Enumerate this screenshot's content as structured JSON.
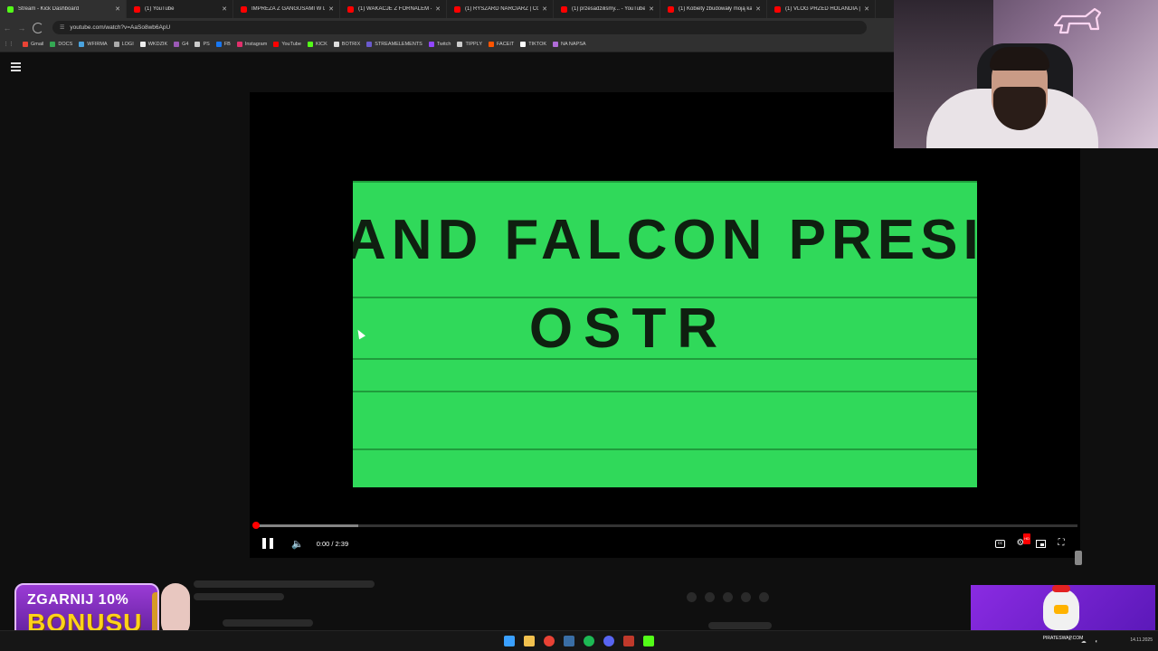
{
  "browser": {
    "tabs": [
      {
        "label": "Stream - Kick Dashboard",
        "favicon": "kick-icon",
        "active": true
      },
      {
        "label": "(1) YouTube",
        "favicon": "youtube-icon",
        "active": false
      },
      {
        "label": "IMPREZA Z GANGUSAMI W DI",
        "favicon": "youtube-icon",
        "active": false
      },
      {
        "label": "(1) WAKACJE Z FORNALEM - Y",
        "favicon": "youtube-icon",
        "active": false
      },
      {
        "label": "(1) RYSZARD NARCIARZ | CO T",
        "favicon": "youtube-icon",
        "active": false
      },
      {
        "label": "(1) przesadziliśmy... - YouTube",
        "favicon": "youtube-icon",
        "active": false
      },
      {
        "label": "(1) Kobiety zbudowały moją ka",
        "favicon": "youtube-icon",
        "active": false
      },
      {
        "label": "(1) VLOG PRZED HOLANDIA | C",
        "favicon": "youtube-icon",
        "active": false
      }
    ],
    "tab_close": "✕",
    "url": "youtube.com/watch?v=AaSo8wb6ApU",
    "bookmarks": [
      {
        "label": "Gmail",
        "color": "#ea4335"
      },
      {
        "label": "DOCS",
        "color": "#34a853"
      },
      {
        "label": "WFIRMA",
        "color": "#4aa3df"
      },
      {
        "label": "LOGI",
        "color": "#aaaaaa"
      },
      {
        "label": "WKDZIK",
        "color": "#eeeeee"
      },
      {
        "label": "G4",
        "color": "#9b59b6"
      },
      {
        "label": "PS",
        "color": "#cccccc"
      },
      {
        "label": "FB",
        "color": "#1877f2"
      },
      {
        "label": "Instagram",
        "color": "#e1306c"
      },
      {
        "label": "YouTube",
        "color": "#ff0000"
      },
      {
        "label": "KICK",
        "color": "#53fc18"
      },
      {
        "label": "BOTRIX",
        "color": "#dddddd"
      },
      {
        "label": "STREAMELEMENTS",
        "color": "#6a5acd"
      },
      {
        "label": "Twitch",
        "color": "#9146ff"
      },
      {
        "label": "TIPPLY",
        "color": "#cccccc"
      },
      {
        "label": "FACEIT",
        "color": "#ff5500"
      },
      {
        "label": "TIKTOK",
        "color": "#ffffff"
      },
      {
        "label": "NA NAPSA",
        "color": "#b06cd8"
      }
    ]
  },
  "video": {
    "frame_text_line1": "AND FALCON PRESI",
    "frame_text_line2": "OSTR",
    "frame_color": "#30d95a",
    "time_display": "0:00 / 2:39",
    "played_fraction": 0.001,
    "buffered_fraction": 0.126
  },
  "promo": {
    "line1": "ZGARNIJ 10%",
    "line2": "BONUSU"
  },
  "pirate": {
    "caption": "PIRATESWAP.COM"
  },
  "taskbar": {
    "icons": [
      {
        "name": "windows-start-icon",
        "color": "#3aa0ff"
      },
      {
        "name": "file-explorer-icon",
        "color": "#f2c14e"
      },
      {
        "name": "chrome-icon",
        "color": "#e94235"
      },
      {
        "name": "steam-icon",
        "color": "#3a6ea5"
      },
      {
        "name": "spotify-icon",
        "color": "#1db954"
      },
      {
        "name": "discord-icon",
        "color": "#5865f2"
      },
      {
        "name": "obs-icon",
        "color": "#c0392b"
      },
      {
        "name": "kick-icon",
        "color": "#53fc18"
      }
    ],
    "date": "14.11.2025"
  }
}
